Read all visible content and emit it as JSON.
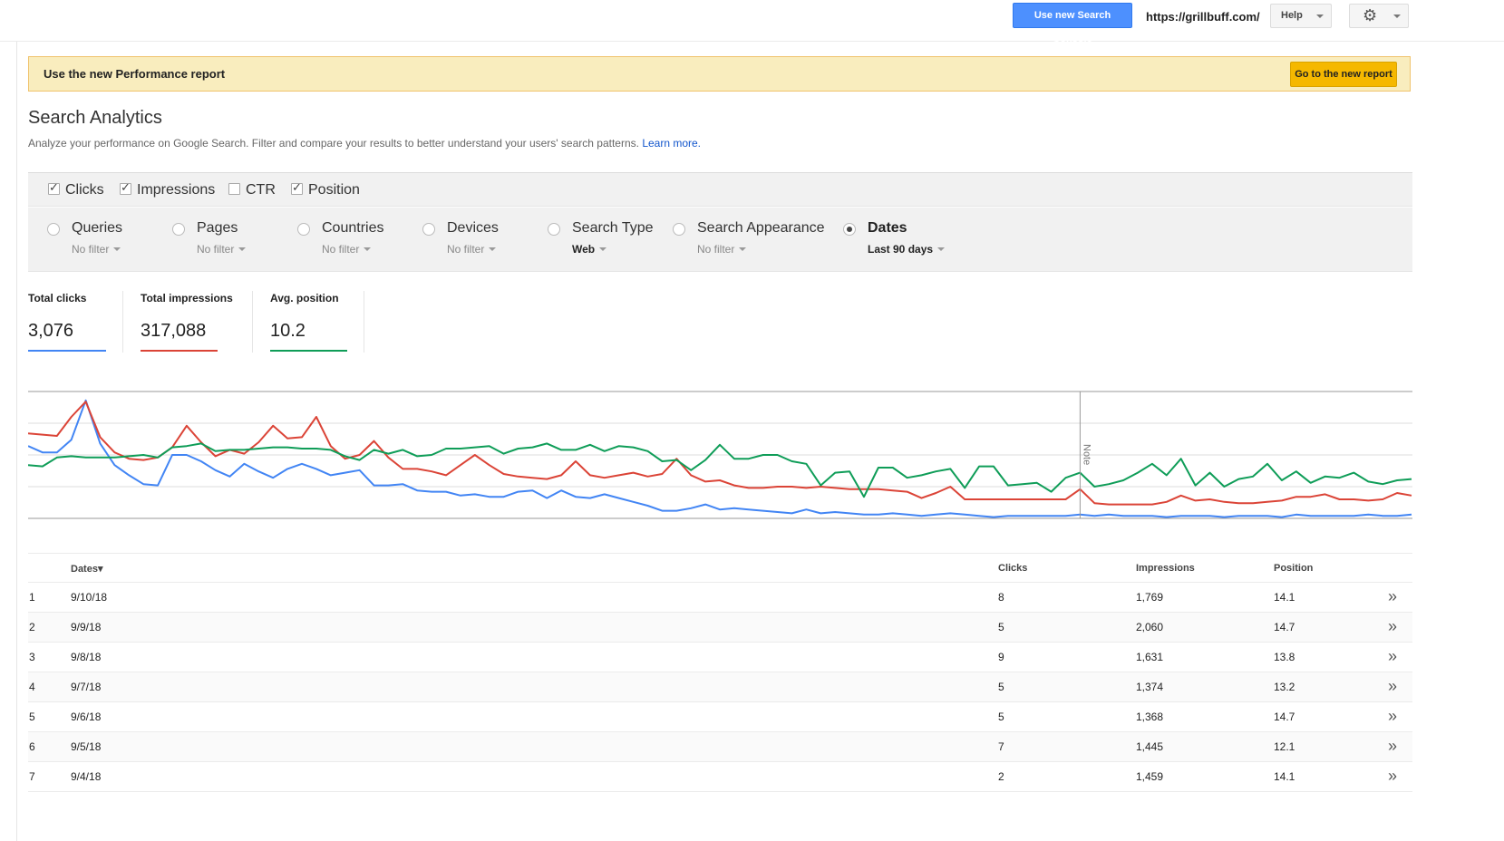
{
  "topbar": {
    "new_console_label": "Use new Search Console",
    "site_url": "https://grillbuff.com/",
    "help_label": "Help",
    "settings_icon": "gear-icon"
  },
  "banner": {
    "text": "Use the new Performance report",
    "button_label": "Go to the new report"
  },
  "page": {
    "title": "Search Analytics",
    "subtitle": "Analyze your performance on Google Search. Filter and compare your results to better understand your users' search patterns.",
    "learn_more": "Learn more."
  },
  "metrics": [
    {
      "label": "Clicks",
      "checked": true
    },
    {
      "label": "Impressions",
      "checked": true
    },
    {
      "label": "CTR",
      "checked": false
    },
    {
      "label": "Position",
      "checked": true
    }
  ],
  "dimensions": [
    {
      "label": "Queries",
      "filter": "No filter",
      "selected": false
    },
    {
      "label": "Pages",
      "filter": "No filter",
      "selected": false
    },
    {
      "label": "Countries",
      "filter": "No filter",
      "selected": false
    },
    {
      "label": "Devices",
      "filter": "No filter",
      "selected": false
    },
    {
      "label": "Search Type",
      "filter": "Web",
      "selected": false
    },
    {
      "label": "Search Appearance",
      "filter": "No filter",
      "selected": false
    },
    {
      "label": "Dates",
      "filter": "Last 90 days",
      "selected": true
    }
  ],
  "totals": [
    {
      "label": "Total clicks",
      "value": "3,076",
      "color": "#4285f4"
    },
    {
      "label": "Total impressions",
      "value": "317,088",
      "color": "#db4437"
    },
    {
      "label": "Avg. position",
      "value": "10.2",
      "color": "#0f9d58"
    }
  ],
  "chart_data": {
    "type": "line",
    "note_label": "Note",
    "note_index": 73,
    "series": [
      {
        "color": "#4285f4",
        "values": [
          0.57,
          0.52,
          0.52,
          0.62,
          0.93,
          0.59,
          0.42,
          0.34,
          0.27,
          0.26,
          0.5,
          0.5,
          0.45,
          0.38,
          0.33,
          0.43,
          0.37,
          0.32,
          0.39,
          0.43,
          0.39,
          0.34,
          0.36,
          0.38,
          0.26,
          0.26,
          0.27,
          0.22,
          0.21,
          0.21,
          0.18,
          0.19,
          0.17,
          0.17,
          0.21,
          0.22,
          0.16,
          0.22,
          0.17,
          0.16,
          0.19,
          0.16,
          0.13,
          0.1,
          0.06,
          0.06,
          0.08,
          0.11,
          0.07,
          0.08,
          0.07,
          0.06,
          0.05,
          0.04,
          0.07,
          0.04,
          0.05,
          0.04,
          0.03,
          0.03,
          0.04,
          0.03,
          0.02,
          0.03,
          0.04,
          0.03,
          0.02,
          0.01,
          0.02,
          0.02,
          0.02,
          0.02,
          0.02,
          0.03,
          0.02,
          0.03,
          0.02,
          0.02,
          0.02,
          0.01,
          0.02,
          0.02,
          0.02,
          0.01,
          0.02,
          0.02,
          0.02,
          0.01,
          0.03,
          0.02,
          0.02,
          0.02,
          0.02,
          0.03,
          0.02,
          0.02,
          0.03
        ]
      },
      {
        "color": "#db4437",
        "values": [
          0.67,
          0.66,
          0.65,
          0.8,
          0.92,
          0.64,
          0.52,
          0.47,
          0.46,
          0.48,
          0.56,
          0.73,
          0.6,
          0.49,
          0.54,
          0.51,
          0.6,
          0.73,
          0.63,
          0.64,
          0.8,
          0.57,
          0.47,
          0.5,
          0.61,
          0.48,
          0.39,
          0.39,
          0.37,
          0.34,
          0.42,
          0.5,
          0.42,
          0.35,
          0.33,
          0.32,
          0.31,
          0.34,
          0.45,
          0.34,
          0.32,
          0.34,
          0.36,
          0.33,
          0.35,
          0.47,
          0.34,
          0.29,
          0.3,
          0.26,
          0.24,
          0.24,
          0.25,
          0.25,
          0.24,
          0.25,
          0.24,
          0.23,
          0.23,
          0.23,
          0.22,
          0.21,
          0.16,
          0.2,
          0.25,
          0.15,
          0.15,
          0.15,
          0.15,
          0.15,
          0.15,
          0.15,
          0.15,
          0.23,
          0.12,
          0.11,
          0.11,
          0.11,
          0.11,
          0.13,
          0.18,
          0.14,
          0.15,
          0.13,
          0.12,
          0.12,
          0.13,
          0.14,
          0.17,
          0.17,
          0.19,
          0.15,
          0.15,
          0.14,
          0.15,
          0.2,
          0.18
        ]
      },
      {
        "color": "#0f9d58",
        "values": [
          0.42,
          0.41,
          0.48,
          0.49,
          0.48,
          0.48,
          0.48,
          0.49,
          0.5,
          0.48,
          0.56,
          0.57,
          0.59,
          0.53,
          0.54,
          0.54,
          0.55,
          0.56,
          0.56,
          0.55,
          0.55,
          0.54,
          0.49,
          0.46,
          0.54,
          0.51,
          0.54,
          0.49,
          0.5,
          0.55,
          0.55,
          0.56,
          0.57,
          0.51,
          0.55,
          0.56,
          0.59,
          0.54,
          0.54,
          0.58,
          0.53,
          0.57,
          0.56,
          0.53,
          0.45,
          0.46,
          0.38,
          0.46,
          0.58,
          0.47,
          0.47,
          0.5,
          0.5,
          0.45,
          0.43,
          0.26,
          0.36,
          0.37,
          0.17,
          0.4,
          0.4,
          0.32,
          0.34,
          0.37,
          0.39,
          0.24,
          0.41,
          0.41,
          0.26,
          0.27,
          0.28,
          0.21,
          0.32,
          0.36,
          0.25,
          0.27,
          0.3,
          0.36,
          0.43,
          0.34,
          0.47,
          0.26,
          0.36,
          0.25,
          0.31,
          0.33,
          0.43,
          0.3,
          0.37,
          0.28,
          0.33,
          0.32,
          0.36,
          0.29,
          0.27,
          0.3,
          0.31
        ]
      }
    ]
  },
  "table": {
    "headers": {
      "dates": "Dates▾",
      "clicks": "Clicks",
      "impressions": "Impressions",
      "position": "Position"
    },
    "rows": [
      {
        "n": "1",
        "date": "9/10/18",
        "clicks": "8",
        "impressions": "1,769",
        "position": "14.1"
      },
      {
        "n": "2",
        "date": "9/9/18",
        "clicks": "5",
        "impressions": "2,060",
        "position": "14.7"
      },
      {
        "n": "3",
        "date": "9/8/18",
        "clicks": "9",
        "impressions": "1,631",
        "position": "13.8"
      },
      {
        "n": "4",
        "date": "9/7/18",
        "clicks": "5",
        "impressions": "1,374",
        "position": "13.2"
      },
      {
        "n": "5",
        "date": "9/6/18",
        "clicks": "5",
        "impressions": "1,368",
        "position": "14.7"
      },
      {
        "n": "6",
        "date": "9/5/18",
        "clicks": "7",
        "impressions": "1,445",
        "position": "12.1"
      },
      {
        "n": "7",
        "date": "9/4/18",
        "clicks": "2",
        "impressions": "1,459",
        "position": "14.1"
      }
    ],
    "more_glyph": "»"
  }
}
